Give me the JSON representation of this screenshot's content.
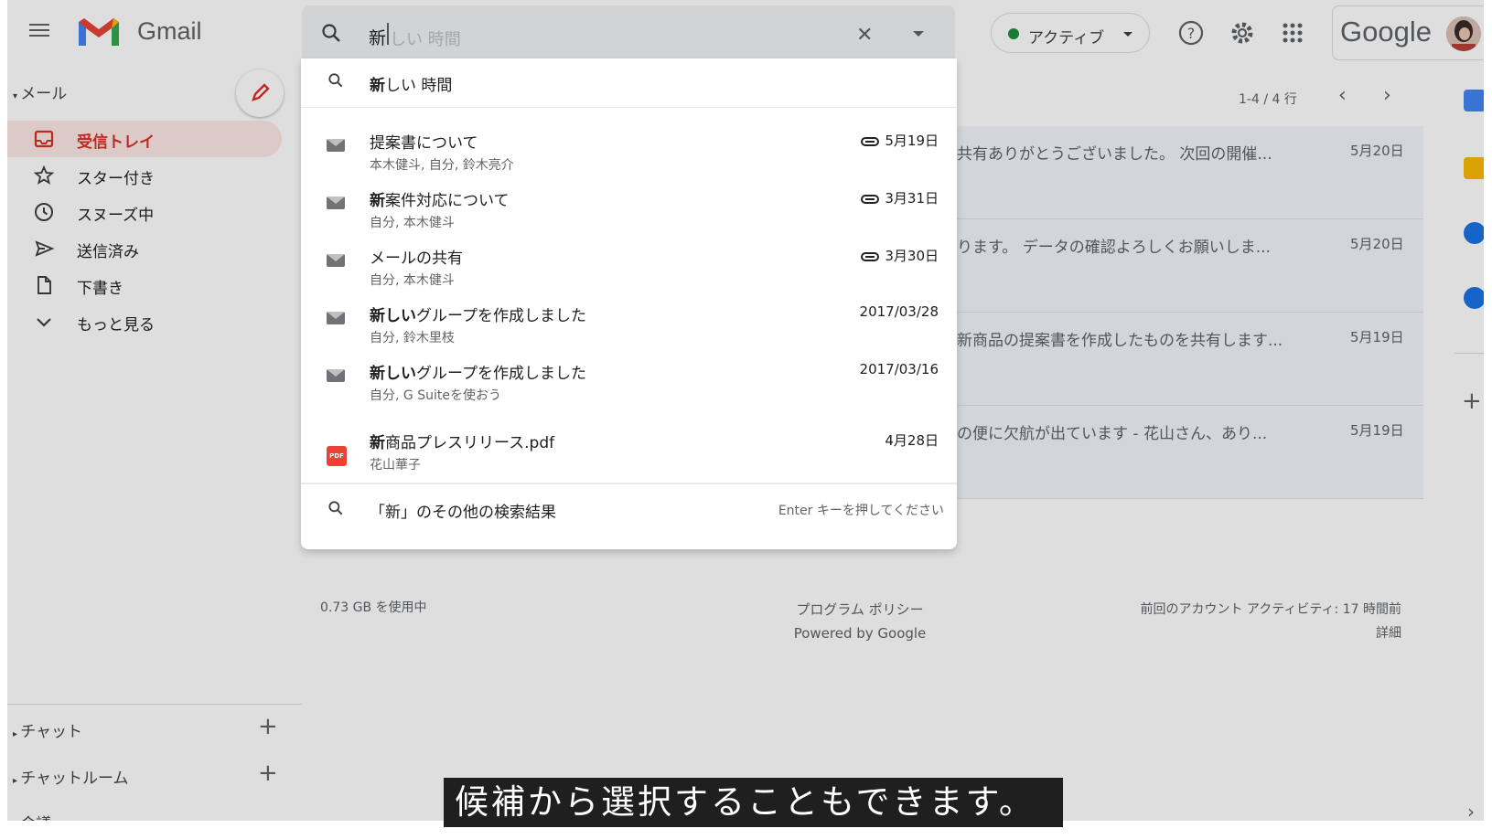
{
  "header": {
    "app_name": "Gmail",
    "search": {
      "value": "新",
      "placeholder": "しい 時間"
    },
    "status": "アクティブ",
    "brand": "Google"
  },
  "sidebar": {
    "mail_section": "メール",
    "items": [
      {
        "label": "受信トレイ",
        "icon": "inbox-icon"
      },
      {
        "label": "スター付き",
        "icon": "star-icon"
      },
      {
        "label": "スヌーズ中",
        "icon": "clock-icon"
      },
      {
        "label": "送信済み",
        "icon": "send-icon"
      },
      {
        "label": "下書き",
        "icon": "draft-icon"
      },
      {
        "label": "もっと見る",
        "icon": "chevron-down-icon"
      }
    ],
    "chat": "チャット",
    "chatroom": "チャットルーム",
    "meet": "会議"
  },
  "list": {
    "pager": "1-4 / 4 行",
    "rows": [
      {
        "snippet": "共有ありがとうございました。 次回の開催...",
        "date": "5月20日"
      },
      {
        "snippet": "ります。 データの確認よろしくお願いしま...",
        "date": "5月20日"
      },
      {
        "snippet": "新商品の提案書を作成したものを共有します...",
        "date": "5月19日"
      },
      {
        "snippet": "の便に欠航が出ています - 花山さん、あり...",
        "date": "5月19日"
      }
    ]
  },
  "footer": {
    "storage": "0.73 GB を使用中",
    "policy": "プログラム ポリシー",
    "powered": "Powered by Google",
    "activity": "前回のアカウント アクティビティ: 17 時間前",
    "details": "詳細"
  },
  "dropdown": {
    "suggestion": {
      "bold": "新",
      "rest": "しい 時間"
    },
    "results": [
      {
        "title_bold": "",
        "title_rest": "提案書について",
        "meta": "本木健斗, 自分, 鈴木亮介",
        "date": "5月19日",
        "attachment": true
      },
      {
        "title_bold": "新",
        "title_rest": "案件対応について",
        "meta": "自分, 本木健斗",
        "date": "3月31日",
        "attachment": true
      },
      {
        "title_bold": "",
        "title_rest": "メールの共有",
        "meta": "自分, 本木健斗",
        "date": "3月30日",
        "attachment": true
      },
      {
        "title_bold": "新しい",
        "title_rest": "グループを作成しました",
        "meta": "自分, 鈴木里枝",
        "date": "2017/03/28",
        "attachment": false
      },
      {
        "title_bold": "新しい",
        "title_rest": "グループを作成しました",
        "meta": "自分, G Suiteを使おう",
        "date": "2017/03/16",
        "attachment": false
      }
    ],
    "file": {
      "title_bold": "新",
      "title_rest": "商品プレスリリース.pdf",
      "meta": "花山華子",
      "date": "4月28日",
      "badge": "PDF"
    },
    "more": {
      "text": "「新」のその他の検索結果",
      "hint": "Enter キーを押してください"
    }
  },
  "caption": "候補から選択することもできます。",
  "colors": {
    "accent": "#d93025",
    "active_bg": "#fce8e6",
    "status_green": "#1e8e3e"
  }
}
